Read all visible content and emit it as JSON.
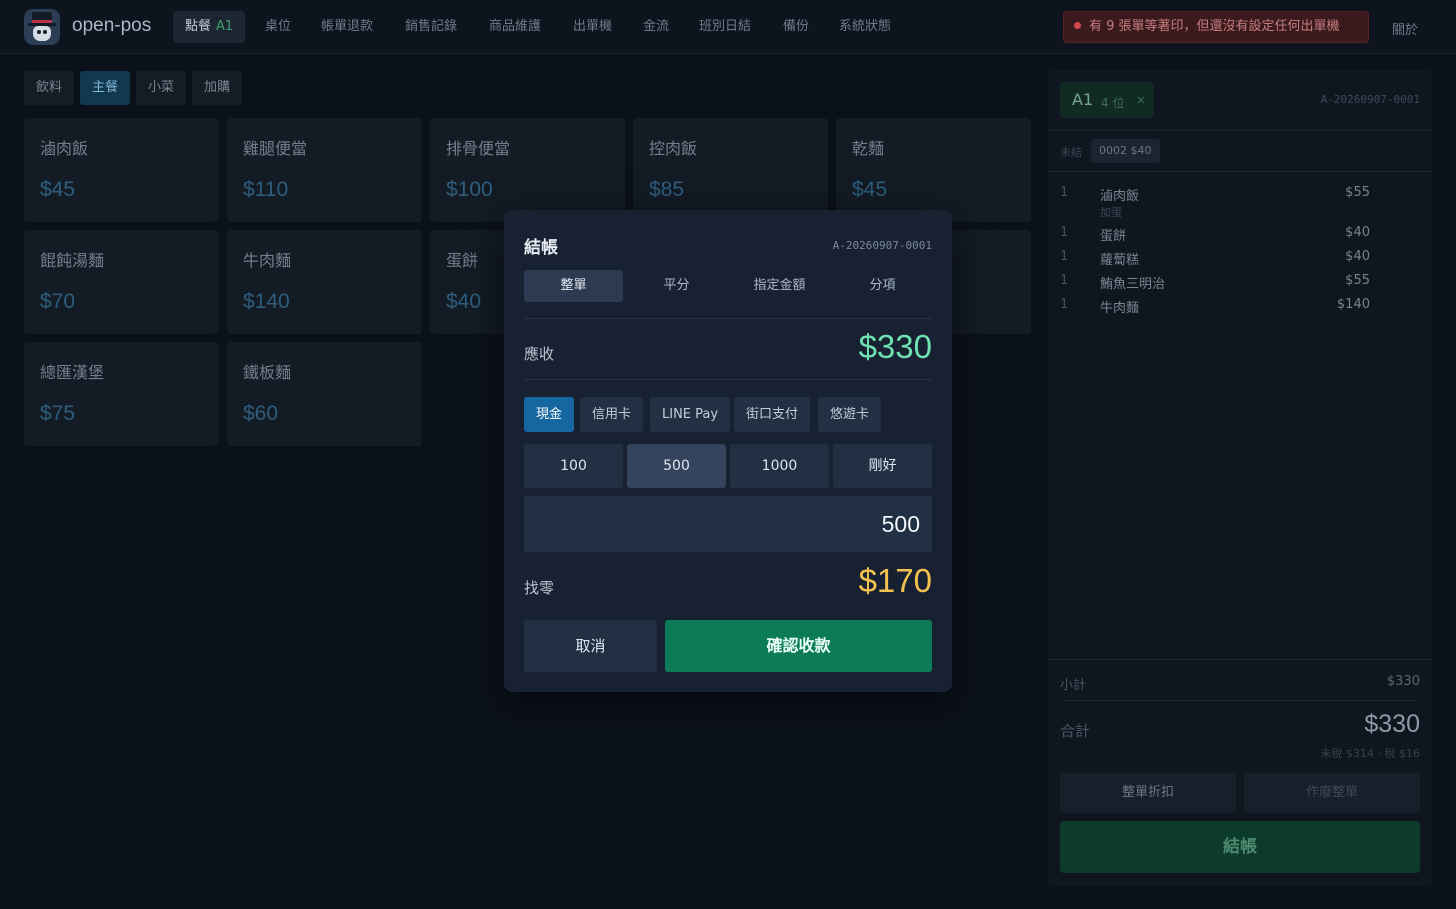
{
  "header": {
    "brand": "open-pos",
    "nav": [
      {
        "label": "點餐",
        "tag": "A1",
        "active": true
      },
      {
        "label": "桌位"
      },
      {
        "label": "帳單退款"
      },
      {
        "label": "銷售記錄"
      },
      {
        "label": "商品維護"
      },
      {
        "label": "出單機"
      },
      {
        "label": "金流"
      },
      {
        "label": "班別日結"
      },
      {
        "label": "備份"
      },
      {
        "label": "系統狀態"
      }
    ],
    "alert": "有 9 張單等著印，但還沒有設定任何出單機",
    "about": "關於"
  },
  "categories": [
    {
      "label": "飲料"
    },
    {
      "label": "主餐",
      "active": true
    },
    {
      "label": "小菜"
    },
    {
      "label": "加購"
    }
  ],
  "products": [
    {
      "name": "滷肉飯",
      "price": "$45"
    },
    {
      "name": "雞腿便當",
      "price": "$110"
    },
    {
      "name": "排骨便當",
      "price": "$100"
    },
    {
      "name": "控肉飯",
      "price": "$85"
    },
    {
      "name": "乾麵",
      "price": "$45"
    },
    {
      "name": "餛飩湯麵",
      "price": "$70"
    },
    {
      "name": "牛肉麵",
      "price": "$140"
    },
    {
      "name": "蛋餅",
      "price": "$40"
    },
    {
      "name": "總匯漢堡",
      "price": "$75"
    },
    {
      "name": "鐵板麵",
      "price": "$60"
    }
  ],
  "order_panel": {
    "table": "A1",
    "seats": "4 位",
    "close_glyph": "×",
    "order_id": "A-20260907-0001",
    "pending_label": "未結",
    "pending_chip": "0002 $40",
    "lines": [
      {
        "qty": "1",
        "name": "滷肉飯",
        "price": "$55",
        "note": "加蛋"
      },
      {
        "qty": "1",
        "name": "蛋餅",
        "price": "$40"
      },
      {
        "qty": "1",
        "name": "蘿蔔糕",
        "price": "$40"
      },
      {
        "qty": "1",
        "name": "鮪魚三明治",
        "price": "$55"
      },
      {
        "qty": "1",
        "name": "牛肉麵",
        "price": "$140"
      }
    ],
    "subtotal_label": "小計",
    "subtotal": "$330",
    "total_label": "合計",
    "total": "$330",
    "tax_line": "未稅 $314 · 稅 $16",
    "discount_button": "整單折扣",
    "void_button": "作廢整單",
    "checkout_button": "結帳"
  },
  "modal": {
    "title": "結帳",
    "order_id": "A-20260907-0001",
    "tabs": [
      {
        "label": "整單",
        "active": true
      },
      {
        "label": "平分"
      },
      {
        "label": "指定金額"
      },
      {
        "label": "分項"
      }
    ],
    "due_label": "應收",
    "due": "$330",
    "methods": [
      {
        "label": "現金",
        "active": true
      },
      {
        "label": "信用卡"
      },
      {
        "label": "LINE Pay"
      },
      {
        "label": "街口支付"
      },
      {
        "label": "悠遊卡"
      }
    ],
    "quick_amounts": [
      {
        "label": "100"
      },
      {
        "label": "500",
        "active": true
      },
      {
        "label": "1000"
      },
      {
        "label": "剛好"
      }
    ],
    "amount_value": "500",
    "change_label": "找零",
    "change": "$170",
    "cancel": "取消",
    "confirm": "確認收款"
  },
  "colors": {
    "accent_green": "#0c7b58",
    "accent_blue": "#1666a0",
    "due_green": "#6fe0b0",
    "change_yellow": "#f2c14e",
    "alert_red": "#d34a4a"
  }
}
